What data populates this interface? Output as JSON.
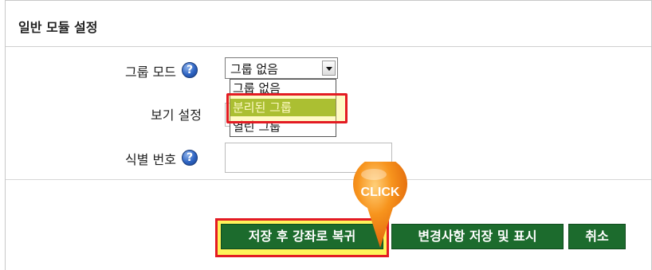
{
  "section": {
    "title": "일반 모듈 설정"
  },
  "rows": {
    "group_mode": {
      "label": "그룹 모드"
    },
    "visibility": {
      "label": "보기 설정"
    },
    "id_number": {
      "label": "식별 번호",
      "value": ""
    }
  },
  "group_select": {
    "value": "그룹 없음",
    "options": [
      "그룹 없음",
      "분리된 그룹",
      "열린 그룹"
    ],
    "highlighted_option": "분리된 그룹"
  },
  "help_icon_glyph": "?",
  "buttons": {
    "save_return": "저장 후 강좌로 복귀",
    "save_display": "변경사항 저장 및 표시",
    "cancel": "취소"
  },
  "annotation": {
    "click_label": "CLICK"
  },
  "colors": {
    "button_green": "#1c6b2d",
    "selected_option": "#7ea51e",
    "highlight_red": "#e31b23",
    "highlight_yellow": "#fff35a",
    "click_orange": "#f7941d"
  },
  "icons": [
    "help-icon",
    "dropdown-arrow-icon",
    "click-pointer-icon"
  ]
}
